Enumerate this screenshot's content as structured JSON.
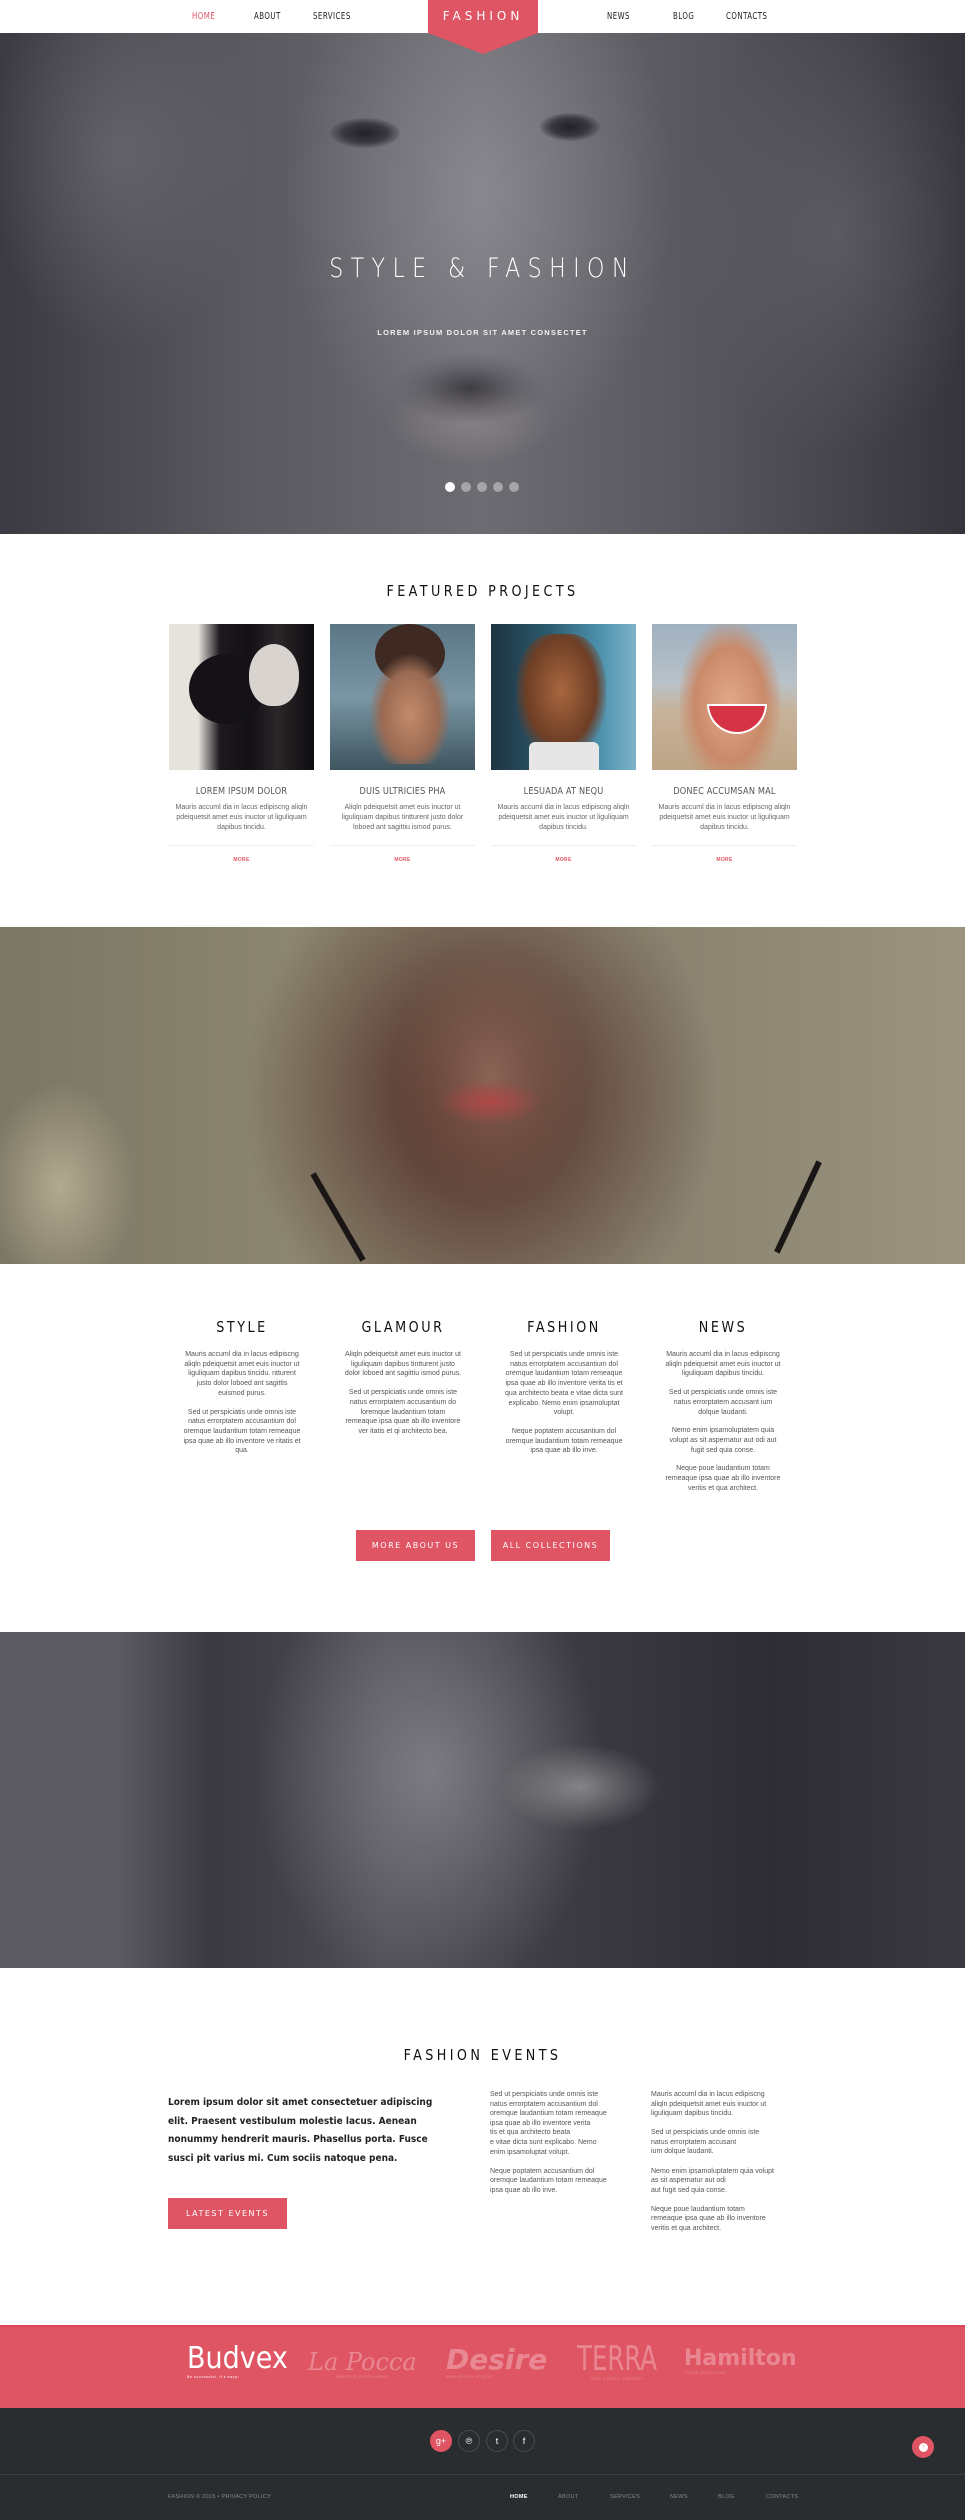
{
  "colors": {
    "accent": "#e05563",
    "footer_bg": "#2a2d2f",
    "text_dark": "#222222"
  },
  "header": {
    "logo": "FASHION",
    "nav_left": [
      {
        "label": "HOME",
        "active": true
      },
      {
        "label": "ABOUT",
        "active": false
      },
      {
        "label": "SERVICES",
        "active": false
      }
    ],
    "nav_right": [
      {
        "label": "NEWS",
        "active": false
      },
      {
        "label": "BLOG",
        "active": false
      },
      {
        "label": "CONTACTS",
        "active": false
      }
    ]
  },
  "hero": {
    "title": "STYLE & FASHION",
    "subtitle": "LOREM IPSUM DOLOR SIT AMET CONSECTET",
    "slides_total": 5,
    "active_slide": 1
  },
  "featured": {
    "title": "FEATURED PROJECTS",
    "items": [
      {
        "title": "LOREM IPSUM DOLOR",
        "desc": "Mauris accuml dia in lacus edipiscng aliqln pdeiquetsit amet euis inuctor ut liguliquam dapibus tincidu.",
        "more": "MORE"
      },
      {
        "title": "DUIS ULTRICIES PHA",
        "desc": "Aliqln pdeiquetsit amet euis inuctor ut liguliquam dapibus tintturent justo dolor loboed ant sagittiu ismod purus.",
        "more": "MORE"
      },
      {
        "title": "LESUADA AT NEQU",
        "desc": "Mauris accuml dia in lacus edipiscng aliqln pdeiquetsit amet euis inuctor ut liguliquam dapibus tincidu.",
        "more": "MORE"
      },
      {
        "title": "DONEC ACCUMSAN MAL",
        "desc": "Mauris accuml dia in lacus edipiscng aliqln pdeiquetsit amet euis inuctor ut liguliquam dapibus tincidu.",
        "more": "MORE"
      }
    ]
  },
  "columns": [
    {
      "title": "STYLE",
      "paragraphs": [
        "Mauris accuml dia in lacus edipiscng aliqln pdeiquetsit amet euis inuctor ut liguliquam dapibus tincidu. ntturent justo dolor loboed ant sagittis euismod purus.",
        "Sed ut perspiciatis unde omnis iste natus errorptatem accusantium dol oremque laudantium totam remeaque ipsa quae ab illo inventore ve ritatis et qua."
      ]
    },
    {
      "title": "GLAMOUR",
      "paragraphs": [
        "Aliqln pdeiquetsit amet euis inuctor ut liguliquam dapibus tintturent justo dolor loboed ant sagittiu ismod purus.",
        "Sed ut perspiciatis unde omnis iste natus errorptatem accusantium do loremque laudantium totam remeaque ipsa quae ab illo inventore ver itatis et qi architecto bea."
      ]
    },
    {
      "title": "FASHION",
      "paragraphs": [
        "Sed ut perspiciatis unde omnis iste natus errorptatem accusantium dol oremque laudantium totam remeaque ipsa quae ab illo inventore verita tis et qua architecto beata e vitae dicta sunt explicabo. Nemo enim ipsamoluptat volupt.",
        "Neque poptatem accusantium dol oremque laudantium totam remeaque ipsa quae ab illo inve."
      ]
    },
    {
      "title": "NEWS",
      "paragraphs": [
        "Mauris accuml dia in lacus edipiscng aliqln pdeiquetsit amet euis inuctor ut liguliquam dapibus tincidu.",
        "Sed ut perspiciatis unde omnis iste natus errorptatem accusant ium dolque laudanti.",
        "Nemo enim ipsamoluptatem quia volupt as sit aspernatur aut odi aut fugit sed quia conse.",
        "Neque poue laudantium totam remeaque ipsa quae ab illo inventore veritis et qua architect."
      ]
    }
  ],
  "buttons": {
    "more_about": "MORE ABOUT US",
    "all_collections": "ALL COLLECTIONS",
    "latest_events": "LATEST EVENTS"
  },
  "events": {
    "title": "FASHION EVENTS",
    "lead": "Lorem ipsum dolor sit amet consectetuer adipiscing elit. Praesent vestibulum molestie lacus. Aenean nonummy hendrerit mauris. Phasellus porta. Fusce susci pit varius mi. Cum sociis natoque pena.",
    "col2": [
      "Sed ut perspiciatis unde omnis iste\nnatus errorptatem accusantium dol\noremque laudantium totam remeaque\nipsa quae ab illo inventore verita\ntis et qua architecto beata\ne vitae dicta sunt explicabo. Nemo\nenim ipsamoluptat volupt.",
      "Neque poptatem accusantium dol\noremque laudantium totam remeaque\nipsa quae ab illo inve."
    ],
    "col3": [
      "Mauris accuml dia in lacus edipiscng\naliqln pdeiquetsit amet euis inuctor ut\nliguliquam dapibus tincidu.",
      "Sed ut perspiciatis unde omnis iste\nnatus errorptatem accusant\nium dolque laudanti.",
      "Nemo enim ipsamoluptatem quia volupt\nas sit aspernatur aut odi\n aut fugit sed quia conse.",
      "Neque poue laudantium totam\nremeaque ipsa quae ab illo inventore\nveritis et qua architect."
    ]
  },
  "brands": [
    {
      "name": "Budvex",
      "tagline": "Be successful, it's easy!",
      "active": true
    },
    {
      "name": "La Pocca",
      "tagline": "SEAFOOD RESTAURANT",
      "active": false
    },
    {
      "name": "Desire",
      "tagline": "WEB DESIGN STUDIO",
      "active": false
    },
    {
      "name": "TERRA",
      "tagline": "REAL ESTATE COMPANY",
      "active": false
    },
    {
      "name": "Hamilton",
      "tagline": "FRESH SOLUTIONS",
      "active": false
    }
  ],
  "footer": {
    "social": [
      {
        "name": "google-plus",
        "glyph": "g+"
      },
      {
        "name": "pinterest",
        "glyph": "℗"
      },
      {
        "name": "twitter",
        "glyph": "t"
      },
      {
        "name": "facebook",
        "glyph": "f"
      }
    ],
    "copyright": "FASHION © 2015 • PRIVACY POLICY",
    "nav": [
      {
        "label": "HOME",
        "active": true
      },
      {
        "label": "ABOUT",
        "active": false
      },
      {
        "label": "SERVICES",
        "active": false
      },
      {
        "label": "NEWS",
        "active": false
      },
      {
        "label": "BLOG",
        "active": false
      },
      {
        "label": "CONTACTS",
        "active": false
      }
    ]
  }
}
